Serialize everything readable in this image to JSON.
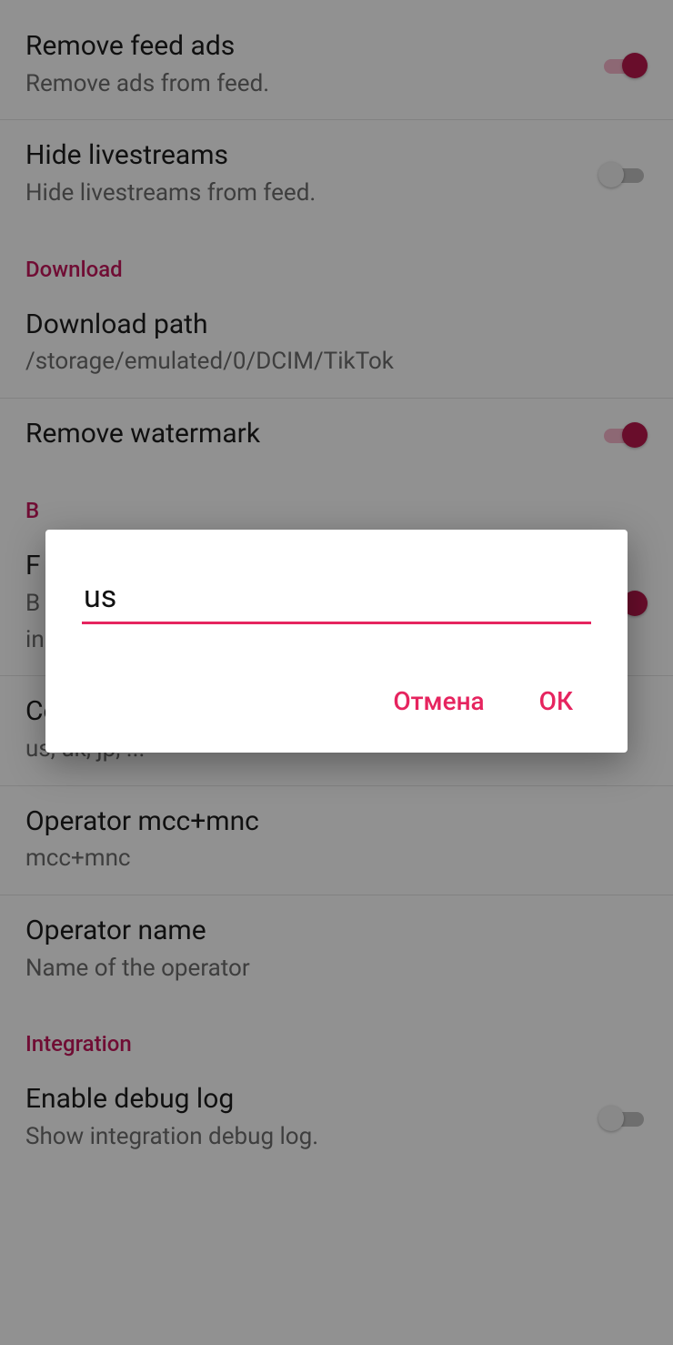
{
  "colors": {
    "accent": "#c2185b",
    "dialog_accent": "#e6245f"
  },
  "settings": {
    "remove_feed_ads": {
      "title": "Remove feed ads",
      "sub": "Remove ads from feed.",
      "on": true
    },
    "hide_livestreams": {
      "title": "Hide livestreams",
      "sub": "Hide livestreams from feed.",
      "on": false
    },
    "section_download": "Download",
    "download_path": {
      "title": "Download path",
      "sub": "/storage/emulated/0/DCIM/TikTok"
    },
    "remove_watermark": {
      "title": "Remove watermark",
      "on": true
    },
    "section_bypass_prefix": "B",
    "fake_item": {
      "title_prefix": "F",
      "sub_line1_prefix": "B",
      "sub_line2_prefix": "in",
      "on": true
    },
    "country_iso": {
      "title": "Country ISO",
      "sub": "us, uk, jp, ..."
    },
    "operator_mcc_mnc": {
      "title": "Operator mcc+mnc",
      "sub": "mcc+mnc"
    },
    "operator_name": {
      "title": "Operator name",
      "sub": "Name of the operator"
    },
    "section_integration": "Integration",
    "enable_debug_log": {
      "title": "Enable debug log",
      "sub": "Show integration debug log.",
      "on": false
    }
  },
  "dialog": {
    "input_value": "us",
    "cancel": "Отмена",
    "ok": "ОК"
  }
}
